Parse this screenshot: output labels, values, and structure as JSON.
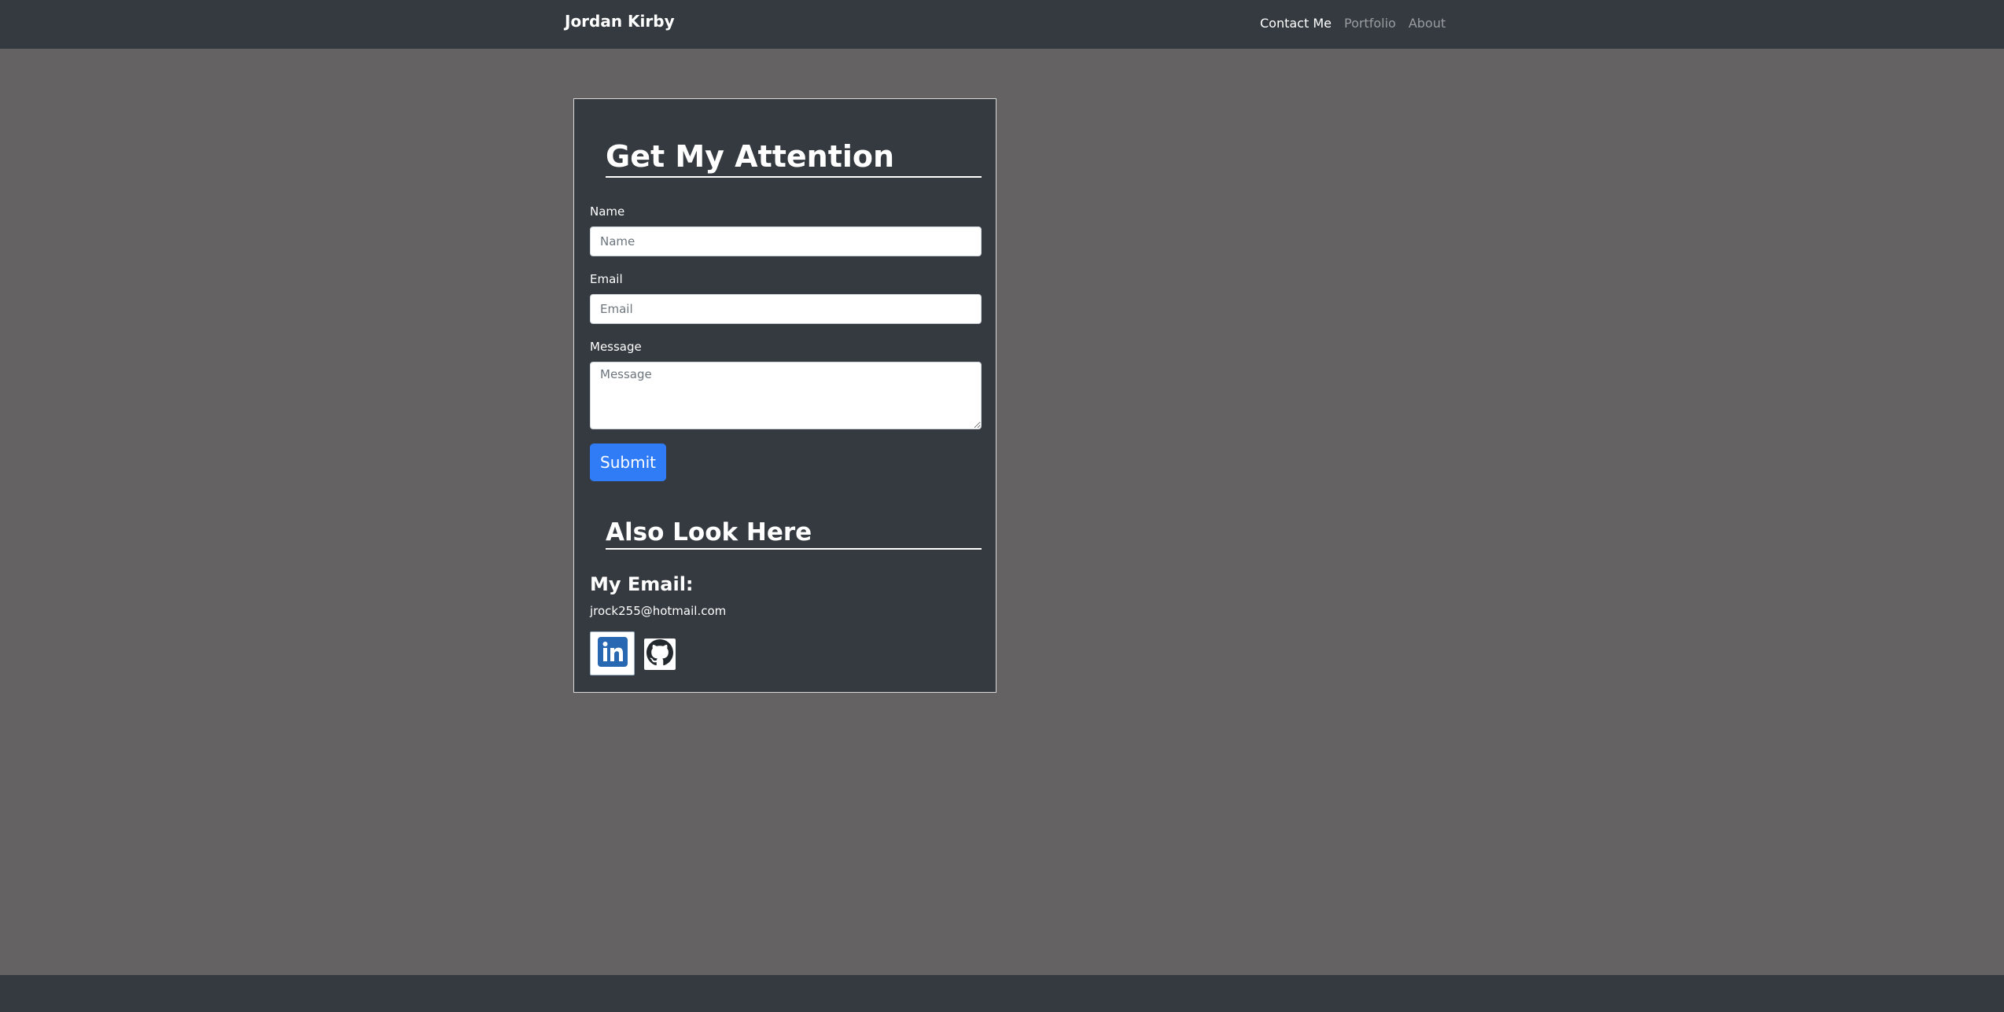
{
  "navbar": {
    "brand": "Jordan Kirby",
    "links": [
      {
        "label": "Contact Me",
        "active": true
      },
      {
        "label": "Portfolio",
        "active": false
      },
      {
        "label": "About",
        "active": false
      }
    ]
  },
  "contact_form": {
    "title": "Get My Attention",
    "name": {
      "label": "Name",
      "placeholder": "Name",
      "value": ""
    },
    "email": {
      "label": "Email",
      "placeholder": "Email",
      "value": ""
    },
    "message": {
      "label": "Message",
      "placeholder": "Message",
      "value": ""
    },
    "submit_label": "Submit"
  },
  "also_look": {
    "title": "Also Look Here",
    "email_heading": "My Email:",
    "email_address": "jrock255@hotmail.com",
    "social_icons": [
      "linkedin-icon",
      "github-icon"
    ]
  },
  "colors": {
    "page_background": "#646263",
    "navbar_background": "#343a40",
    "card_background": "#343a40",
    "submit_button": "#2f7cf6",
    "linkedin_blue": "#2867b2"
  }
}
